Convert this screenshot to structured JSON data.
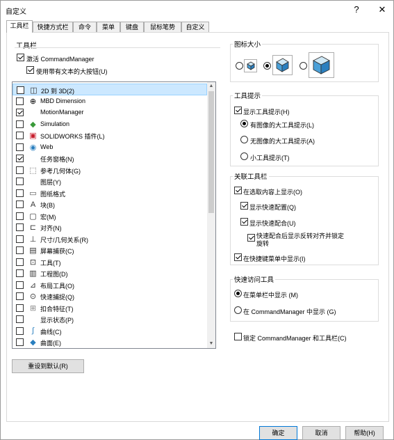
{
  "window": {
    "title": "自定义",
    "help_glyph": "?",
    "close_glyph": "✕"
  },
  "tabs": [
    "工具栏",
    "快捷方式栏",
    "命令",
    "菜单",
    "键盘",
    "鼠标笔势",
    "自定义"
  ],
  "toolbars_section": {
    "title": "工具栏",
    "activate_cm": {
      "label": "激活 CommandManager",
      "checked": true
    },
    "large_buttons": {
      "label": "使用带有文本的大按钮(U)",
      "checked": true
    }
  },
  "toolbar_list": [
    {
      "label": "2D 到 3D(2)",
      "checked": false,
      "icon": "2d-to-3d-icon",
      "selected": true
    },
    {
      "label": "MBD Dimension",
      "checked": false,
      "icon": "mbd-dimension-icon"
    },
    {
      "label": "MotionManager",
      "checked": true,
      "icon": "none"
    },
    {
      "label": "Simulation",
      "checked": false,
      "icon": "simulation-icon"
    },
    {
      "label": "SOLIDWORKS 插件(L)",
      "checked": false,
      "icon": "solidworks-addins-icon"
    },
    {
      "label": "Web",
      "checked": false,
      "icon": "web-icon"
    },
    {
      "label": "任务窗格(N)",
      "checked": true,
      "icon": "none"
    },
    {
      "label": "参考几何体(G)",
      "checked": false,
      "icon": "reference-geometry-icon"
    },
    {
      "label": "图层(Y)",
      "checked": false,
      "icon": "none"
    },
    {
      "label": "图纸格式",
      "checked": false,
      "icon": "sheet-format-icon"
    },
    {
      "label": "块(B)",
      "checked": false,
      "icon": "block-icon"
    },
    {
      "label": "宏(M)",
      "checked": false,
      "icon": "macro-icon"
    },
    {
      "label": "对齐(N)",
      "checked": false,
      "icon": "align-icon"
    },
    {
      "label": "尺寸/几何关系(R)",
      "checked": false,
      "icon": "dimensions-relations-icon"
    },
    {
      "label": "屏幕捕获(C)",
      "checked": false,
      "icon": "screen-capture-icon"
    },
    {
      "label": "工具(T)",
      "checked": false,
      "icon": "tools-icon"
    },
    {
      "label": "工程图(D)",
      "checked": false,
      "icon": "drawing-icon"
    },
    {
      "label": "布局工具(O)",
      "checked": false,
      "icon": "layout-tools-icon"
    },
    {
      "label": "快速捕捉(Q)",
      "checked": false,
      "icon": "quick-snaps-icon"
    },
    {
      "label": "扣合特征(T)",
      "checked": false,
      "icon": "fastening-features-icon"
    },
    {
      "label": "显示状态(P)",
      "checked": false,
      "icon": "none"
    },
    {
      "label": "曲线(C)",
      "checked": false,
      "icon": "curves-icon"
    },
    {
      "label": "曲面(E)",
      "checked": false,
      "icon": "surfaces-icon"
    }
  ],
  "icon_size": {
    "title": "图标大小",
    "options": [
      "small",
      "medium",
      "large"
    ],
    "selected": 1
  },
  "tooltips": {
    "title": "工具提示",
    "show": {
      "label": "显示工具提示(H)",
      "checked": true
    },
    "options": [
      "有图像的大工具提示(L)",
      "无图像的大工具提示(A)",
      "小工具提示(T)"
    ],
    "selected": 0
  },
  "context_toolbars": {
    "title": "关联工具栏",
    "show_on_selection": {
      "label": "在选取内容上显示(O)",
      "checked": true
    },
    "show_quick_config": {
      "label": "显示快速配置(Q)",
      "checked": true
    },
    "show_quick_mates": {
      "label": "显示快速配合(U)",
      "checked": true
    },
    "reverse_align": {
      "label": "快速配合后显示反转对齐并锁定旋转",
      "checked": true
    },
    "show_in_shortcut": {
      "label": "在快捷键菜单中显示(I)",
      "checked": true
    }
  },
  "quick_access": {
    "title": "快速访问工具",
    "options": [
      "在菜单栏中显示 (M)",
      "在 CommandManager 中显示 (G)"
    ],
    "selected": 0
  },
  "lock": {
    "label": "锁定 CommandManager 和工具栏(C)",
    "checked": false
  },
  "reset_button": "重设到默认(R)",
  "buttons": {
    "ok": "确定",
    "cancel": "取消",
    "help": "帮助(H)"
  },
  "colors": {
    "accent": "#0078d7",
    "selection": "#cce8ff"
  }
}
